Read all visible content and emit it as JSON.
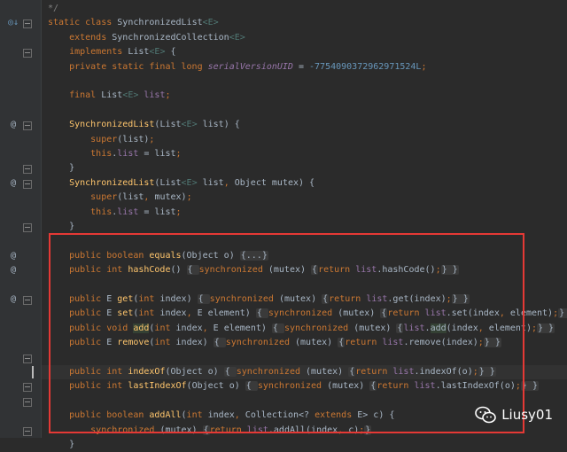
{
  "editor": {
    "lines": [
      {
        "tokens": [
          {
            "c": "cmt",
            "t": "*/"
          }
        ]
      },
      {
        "tokens": [
          {
            "c": "kw",
            "t": "static class "
          },
          {
            "c": "id",
            "t": "SynchronizedList"
          },
          {
            "c": "gen",
            "t": "<E>"
          }
        ]
      },
      {
        "tokens": [
          {
            "c": "kw",
            "t": "    extends "
          },
          {
            "c": "id",
            "t": "SynchronizedCollection"
          },
          {
            "c": "gen",
            "t": "<E>"
          }
        ]
      },
      {
        "tokens": [
          {
            "c": "kw",
            "t": "    implements "
          },
          {
            "c": "id",
            "t": "List"
          },
          {
            "c": "gen",
            "t": "<E>"
          },
          {
            "c": "id",
            "t": " {"
          }
        ]
      },
      {
        "tokens": [
          {
            "c": "kw",
            "t": "    private static final long "
          },
          {
            "c": "field italic",
            "t": "serialVersionUID"
          },
          {
            "c": "id",
            "t": " = "
          },
          {
            "c": "num",
            "t": "-7754090372962971524L"
          },
          {
            "c": "kw",
            "t": ";"
          }
        ]
      },
      {
        "tokens": []
      },
      {
        "tokens": [
          {
            "c": "kw",
            "t": "    final "
          },
          {
            "c": "id",
            "t": "List"
          },
          {
            "c": "gen",
            "t": "<E>"
          },
          {
            "c": "field",
            "t": " list"
          },
          {
            "c": "kw",
            "t": ";"
          }
        ]
      },
      {
        "tokens": []
      },
      {
        "tokens": [
          {
            "c": "fn",
            "t": "    SynchronizedList"
          },
          {
            "c": "id",
            "t": "(List"
          },
          {
            "c": "gen",
            "t": "<E>"
          },
          {
            "c": "id",
            "t": " list) {"
          }
        ]
      },
      {
        "tokens": [
          {
            "c": "kw",
            "t": "        super"
          },
          {
            "c": "id",
            "t": "(list)"
          },
          {
            "c": "kw",
            "t": ";"
          }
        ]
      },
      {
        "tokens": [
          {
            "c": "kw",
            "t": "        this"
          },
          {
            "c": "id",
            "t": "."
          },
          {
            "c": "field",
            "t": "list"
          },
          {
            "c": "id",
            "t": " = list"
          },
          {
            "c": "kw",
            "t": ";"
          }
        ]
      },
      {
        "tokens": [
          {
            "c": "id",
            "t": "    }"
          }
        ]
      },
      {
        "tokens": [
          {
            "c": "fn",
            "t": "    SynchronizedList"
          },
          {
            "c": "id",
            "t": "(List"
          },
          {
            "c": "gen",
            "t": "<E>"
          },
          {
            "c": "id",
            "t": " list"
          },
          {
            "c": "kw",
            "t": ", "
          },
          {
            "c": "id",
            "t": "Object mutex) {"
          }
        ]
      },
      {
        "tokens": [
          {
            "c": "kw",
            "t": "        super"
          },
          {
            "c": "id",
            "t": "(list"
          },
          {
            "c": "kw",
            "t": ", "
          },
          {
            "c": "id",
            "t": "mutex)"
          },
          {
            "c": "kw",
            "t": ";"
          }
        ]
      },
      {
        "tokens": [
          {
            "c": "kw",
            "t": "        this"
          },
          {
            "c": "id",
            "t": "."
          },
          {
            "c": "field",
            "t": "list"
          },
          {
            "c": "id",
            "t": " = list"
          },
          {
            "c": "kw",
            "t": ";"
          }
        ]
      },
      {
        "tokens": [
          {
            "c": "id",
            "t": "    }"
          }
        ]
      },
      {
        "tokens": []
      },
      {
        "tokens": [
          {
            "c": "kw",
            "t": "    public boolean "
          },
          {
            "c": "fn",
            "t": "equals"
          },
          {
            "c": "id",
            "t": "(Object o) "
          },
          {
            "c": "fold-box",
            "t": "{...}"
          }
        ]
      },
      {
        "tokens": [
          {
            "c": "kw",
            "t": "    public int "
          },
          {
            "c": "fn",
            "t": "hashCode"
          },
          {
            "c": "id",
            "t": "() "
          },
          {
            "c": "fold-box",
            "t": "{ "
          },
          {
            "c": "kw",
            "t": "synchronized "
          },
          {
            "c": "id",
            "t": "(mutex) "
          },
          {
            "c": "fold-box",
            "t": "{"
          },
          {
            "c": "kw",
            "t": "return "
          },
          {
            "c": "field",
            "t": "list"
          },
          {
            "c": "id",
            "t": ".hashCode()"
          },
          {
            "c": "kw",
            "t": ";"
          },
          {
            "c": "fold-box",
            "t": "} }"
          }
        ]
      },
      {
        "tokens": []
      },
      {
        "tokens": [
          {
            "c": "kw",
            "t": "    public "
          },
          {
            "c": "id",
            "t": "E "
          },
          {
            "c": "fn",
            "t": "get"
          },
          {
            "c": "id",
            "t": "("
          },
          {
            "c": "kw",
            "t": "int "
          },
          {
            "c": "id",
            "t": "index) "
          },
          {
            "c": "fold-box",
            "t": "{ "
          },
          {
            "c": "kw",
            "t": "synchronized "
          },
          {
            "c": "id",
            "t": "(mutex) "
          },
          {
            "c": "fold-box",
            "t": "{"
          },
          {
            "c": "kw",
            "t": "return "
          },
          {
            "c": "field",
            "t": "list"
          },
          {
            "c": "id",
            "t": ".get(index)"
          },
          {
            "c": "kw",
            "t": ";"
          },
          {
            "c": "fold-box",
            "t": "} }"
          }
        ]
      },
      {
        "tokens": [
          {
            "c": "kw",
            "t": "    public "
          },
          {
            "c": "id",
            "t": "E "
          },
          {
            "c": "fn",
            "t": "set"
          },
          {
            "c": "id",
            "t": "("
          },
          {
            "c": "kw",
            "t": "int "
          },
          {
            "c": "id",
            "t": "index"
          },
          {
            "c": "kw",
            "t": ", "
          },
          {
            "c": "id",
            "t": "E element) "
          },
          {
            "c": "fold-box",
            "t": "{ "
          },
          {
            "c": "kw",
            "t": "synchronized "
          },
          {
            "c": "id",
            "t": "(mutex) "
          },
          {
            "c": "fold-box",
            "t": "{"
          },
          {
            "c": "kw",
            "t": "return "
          },
          {
            "c": "field",
            "t": "list"
          },
          {
            "c": "id",
            "t": ".set(index"
          },
          {
            "c": "kw",
            "t": ", "
          },
          {
            "c": "id",
            "t": "element)"
          },
          {
            "c": "kw",
            "t": ";"
          },
          {
            "c": "fold-box",
            "t": "} }"
          }
        ]
      },
      {
        "tokens": [
          {
            "c": "kw",
            "t": "    public void "
          },
          {
            "c": "fn hl",
            "t": "add"
          },
          {
            "c": "id",
            "t": "("
          },
          {
            "c": "kw",
            "t": "int "
          },
          {
            "c": "id",
            "t": "index"
          },
          {
            "c": "kw",
            "t": ", "
          },
          {
            "c": "id",
            "t": "E element) "
          },
          {
            "c": "fold-box",
            "t": "{ "
          },
          {
            "c": "kw",
            "t": "synchronized "
          },
          {
            "c": "id",
            "t": "(mutex) "
          },
          {
            "c": "fold-box",
            "t": "{"
          },
          {
            "c": "field",
            "t": "list"
          },
          {
            "c": "id",
            "t": "."
          },
          {
            "c": "id hl",
            "t": "add"
          },
          {
            "c": "id",
            "t": "(index"
          },
          {
            "c": "kw",
            "t": ", "
          },
          {
            "c": "id",
            "t": "element)"
          },
          {
            "c": "kw",
            "t": ";"
          },
          {
            "c": "fold-box",
            "t": "} }"
          }
        ]
      },
      {
        "tokens": [
          {
            "c": "kw",
            "t": "    public "
          },
          {
            "c": "id",
            "t": "E "
          },
          {
            "c": "fn",
            "t": "remove"
          },
          {
            "c": "id",
            "t": "("
          },
          {
            "c": "kw",
            "t": "int "
          },
          {
            "c": "id",
            "t": "index) "
          },
          {
            "c": "fold-box",
            "t": "{ "
          },
          {
            "c": "kw",
            "t": "synchronized "
          },
          {
            "c": "id",
            "t": "(mutex) "
          },
          {
            "c": "fold-box",
            "t": "{"
          },
          {
            "c": "kw",
            "t": "return "
          },
          {
            "c": "field",
            "t": "list"
          },
          {
            "c": "id",
            "t": ".remove(index)"
          },
          {
            "c": "kw",
            "t": ";"
          },
          {
            "c": "fold-box",
            "t": "} }"
          }
        ]
      },
      {
        "tokens": []
      },
      {
        "tokens": [
          {
            "c": "kw",
            "t": "    public int "
          },
          {
            "c": "fn",
            "t": "indexOf"
          },
          {
            "c": "id",
            "t": "(Object o) "
          },
          {
            "c": "fold-box",
            "t": "{ "
          },
          {
            "c": "kw",
            "t": "synchronized "
          },
          {
            "c": "id",
            "t": "(mutex) "
          },
          {
            "c": "fold-box",
            "t": "{"
          },
          {
            "c": "kw",
            "t": "return "
          },
          {
            "c": "field",
            "t": "list"
          },
          {
            "c": "id",
            "t": ".indexOf(o)"
          },
          {
            "c": "kw",
            "t": ";"
          },
          {
            "c": "fold-box",
            "t": "} }"
          }
        ]
      },
      {
        "tokens": [
          {
            "c": "kw",
            "t": "    public int "
          },
          {
            "c": "fn",
            "t": "lastIndexOf"
          },
          {
            "c": "id",
            "t": "(Object o) "
          },
          {
            "c": "fold-box",
            "t": "{ "
          },
          {
            "c": "kw",
            "t": "synchronized "
          },
          {
            "c": "id",
            "t": "(mutex) "
          },
          {
            "c": "fold-box",
            "t": "{"
          },
          {
            "c": "kw",
            "t": "return "
          },
          {
            "c": "field",
            "t": "list"
          },
          {
            "c": "id",
            "t": ".lastIndexOf(o)"
          },
          {
            "c": "kw",
            "t": ";"
          },
          {
            "c": "fold-box",
            "t": "} }"
          }
        ]
      },
      {
        "tokens": []
      },
      {
        "tokens": [
          {
            "c": "kw",
            "t": "    public boolean "
          },
          {
            "c": "fn",
            "t": "addAll"
          },
          {
            "c": "id",
            "t": "("
          },
          {
            "c": "kw",
            "t": "int "
          },
          {
            "c": "id",
            "t": "index"
          },
          {
            "c": "kw",
            "t": ", "
          },
          {
            "c": "id",
            "t": "Collection<? "
          },
          {
            "c": "kw",
            "t": "extends "
          },
          {
            "c": "id",
            "t": "E> c) {"
          }
        ]
      },
      {
        "tokens": [
          {
            "c": "kw",
            "t": "        synchronized "
          },
          {
            "c": "id",
            "t": "(mutex) "
          },
          {
            "c": "fold-box",
            "t": "{"
          },
          {
            "c": "kw",
            "t": "return "
          },
          {
            "c": "field",
            "t": "list"
          },
          {
            "c": "id",
            "t": ".addAll(index"
          },
          {
            "c": "kw",
            "t": ", "
          },
          {
            "c": "id",
            "t": "c)"
          },
          {
            "c": "kw",
            "t": ";"
          },
          {
            "c": "fold-box",
            "t": "}"
          }
        ]
      },
      {
        "tokens": [
          {
            "c": "id",
            "t": "    }"
          }
        ]
      }
    ],
    "gutter_markers": [
      {
        "line": 1,
        "icon": "override-inherit-icon",
        "glyph": "◎↓"
      },
      {
        "line": 8,
        "icon": "annotation-at-icon",
        "glyph": "@"
      },
      {
        "line": 12,
        "icon": "annotation-at-icon",
        "glyph": "@"
      },
      {
        "line": 17,
        "icon": "annotation-at-icon",
        "glyph": "@"
      },
      {
        "line": 18,
        "icon": "annotation-at-icon",
        "glyph": "@"
      },
      {
        "line": 20,
        "icon": "annotation-at-icon",
        "glyph": "@"
      }
    ],
    "fold_lines": [
      1,
      3,
      8,
      11,
      12,
      15,
      20,
      24,
      26,
      27,
      29
    ],
    "current_line": 25
  },
  "watermark": {
    "text": "Liusy01",
    "icon": "wechat-logo-icon"
  },
  "colors": {
    "background": "#2b2b2b",
    "gutter": "#313335",
    "keyword": "#cc7832",
    "method": "#ffc66d",
    "field": "#9876aa",
    "number": "#6897bb",
    "highlight_box": "#e53935"
  }
}
